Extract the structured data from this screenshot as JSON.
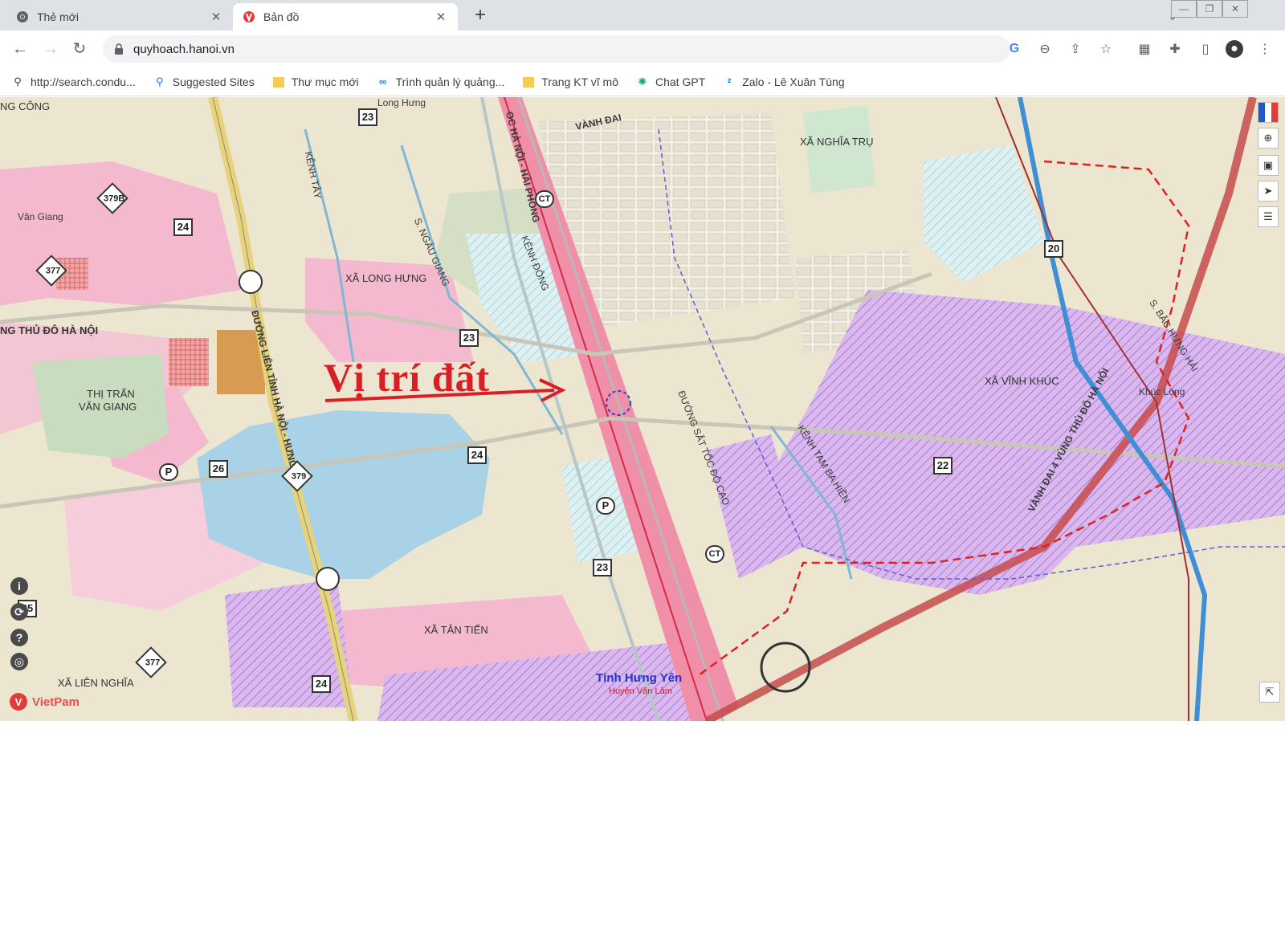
{
  "browser": {
    "tabs": [
      {
        "title": "Thẻ mới",
        "icon": "chrome-icon",
        "active": false
      },
      {
        "title": "Bản đồ",
        "icon": "vietmap-favicon",
        "active": true
      }
    ],
    "new_tab": "+",
    "url": "quyhoach.hanoi.vn"
  },
  "bookmarks": [
    {
      "label": "http://search.condu...",
      "icon": "key-icon"
    },
    {
      "label": "Suggested Sites",
      "icon": "search-icon"
    },
    {
      "label": "Thư mục mới",
      "icon": "folder-icon"
    },
    {
      "label": "Trình quản lý quảng...",
      "icon": "meta-icon"
    },
    {
      "label": "Trang KT vĩ mô",
      "icon": "folder-icon"
    },
    {
      "label": "Chat GPT",
      "icon": "chatgpt-icon"
    },
    {
      "label": "Zalo - Lê Xuân Tùng",
      "icon": "zalo-icon"
    }
  ],
  "map": {
    "callout": "Vị trí đất",
    "labels": {
      "xa_long_hung": "XÃ LONG HƯNG",
      "thi_tran": "THỊ TRẤN",
      "van_giang": "VĂN GIANG",
      "van_giang_small": "Văn Giang",
      "xa_nghia_tru": "XÃ NGHĨA TRỤ",
      "xa_vinh_khuc": "XÃ VĨNH KHÚC",
      "khuc_long": "Khúc Lộng",
      "xa_tan_tien": "XÃ TÂN TIẾN",
      "xa_lien_nghia": "XÃ LIÊN NGHĨA",
      "vung_thu_do_left": "NG THỦ ĐÔ HÀ NỘI",
      "road_hanoi_hungyen": "ĐƯỜNG LIÊN TỈNH HÀ NỘI - HƯNG YÊN",
      "road_hanoi_haiphong": "OC HÀ NỘI - HẢI PHÒNG",
      "vanh_dai": "VÀNH ĐAI",
      "vanh_dai_4": "VÀNH ĐAI 4 VÙNG THỦ ĐÔ HÀ NỘI",
      "kenh_dong": "KÊNH ĐÔNG",
      "kenh_tay": "KÊNH TÂY",
      "kenh_tam_ba_hien": "KÊNH TAM BA HIỀN",
      "song_ngau_giang": "S. NGÂU GIANG",
      "duong_sat": "ĐƯỜNG SẮT TỐC ĐỘ CAO",
      "bac_hung_hai": "S. BẮC HƯNG HẢI",
      "ng_cong": "NG CÔNG",
      "long_hung_top": "Long Hưng"
    },
    "road_numbers": {
      "r23a": "23",
      "r24a": "24",
      "r23b": "23",
      "r24b": "24",
      "r26": "26",
      "r23c": "23",
      "r24c": "24",
      "r25": "25",
      "r22": "22",
      "r20": "20"
    },
    "diamond_roads": {
      "d379b": "379B",
      "d377a": "377",
      "d379": "379",
      "d377b": "377"
    },
    "ct_markers": {
      "ct1": "CT",
      "ct2": "CT"
    },
    "parking": "P",
    "province": "Tỉnh Hưng Yên",
    "district": "Huyện Văn Lâm",
    "brand": "VietPam",
    "side_icons": {
      "info": "i",
      "history": "⟳",
      "help": "?",
      "globe": "◎"
    }
  }
}
